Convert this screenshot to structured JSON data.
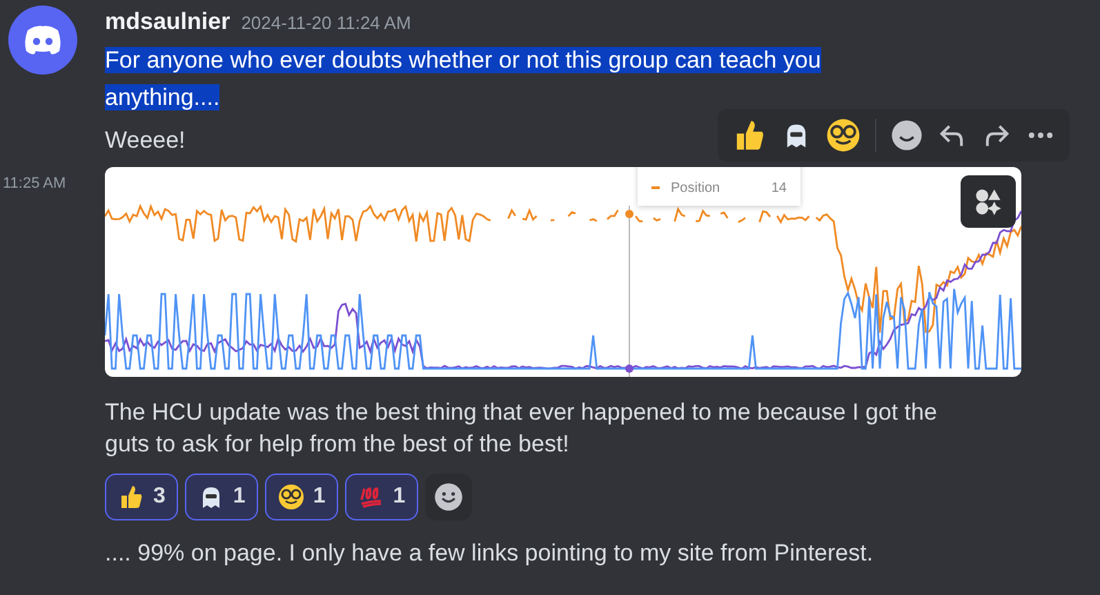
{
  "message": {
    "author": "mdsaulnier",
    "timestamp": "2024-11-20 11:24 AM",
    "lines": [
      {
        "text": "For anyone who ever doubts whether or not this group can teach you anything....",
        "selected": true
      },
      {
        "text": "Weeee!",
        "selected": false
      }
    ]
  },
  "followup": {
    "timestamp": "11:25 AM",
    "attachment": {
      "legend": {
        "label": "Position",
        "value": "14"
      }
    },
    "text": "The HCU update was the best thing that ever happened to me because I got the guts to ask for help from the best of the best!",
    "reactions": [
      {
        "kind": "thumbs",
        "count": "3",
        "selected": true
      },
      {
        "kind": "ghost",
        "count": "1",
        "selected": true
      },
      {
        "kind": "nerd",
        "count": "1",
        "selected": true
      },
      {
        "kind": "hundred",
        "count": "1",
        "selected": true
      }
    ]
  },
  "last_message": {
    "text": ".... 99% on page. I only have a few links pointing to my site from Pinterest."
  }
}
